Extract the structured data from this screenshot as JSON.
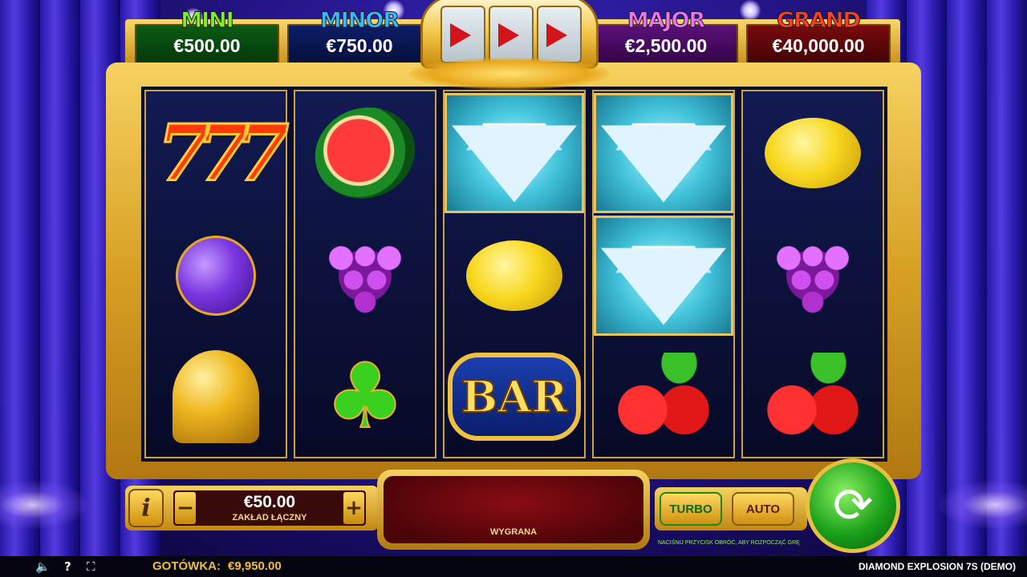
{
  "jackpots": {
    "mini": {
      "label": "MINI",
      "value": "€500.00"
    },
    "minor": {
      "label": "MINOR",
      "value": "€750.00"
    },
    "major": {
      "label": "MAJOR",
      "value": "€2,500.00"
    },
    "grand": {
      "label": "GRAND",
      "value": "€40,000.00"
    }
  },
  "reels": [
    [
      "sevens",
      "plum",
      "bell"
    ],
    [
      "watermelon",
      "grapes",
      "clover"
    ],
    [
      "diamond",
      "lemon",
      "bar"
    ],
    [
      "diamond",
      "diamond",
      "cherries"
    ],
    [
      "lemon",
      "grapes",
      "cherries"
    ]
  ],
  "symbols": {
    "sevens_text": "777",
    "bar_text": "BAR",
    "clover_glyph": "♣"
  },
  "controls": {
    "info_label": "i",
    "minus_label": "−",
    "plus_label": "+",
    "bet_value": "€50.00",
    "bet_label": "ZAKŁAD ŁĄCZNY",
    "win_label": "WYGRANA",
    "turbo_label": "TURBO",
    "auto_label": "AUTO",
    "hint": "NACIŚNIJ PRZYCISK OBRÓĆ, ABY ROZPOCZĄĆ GRĘ",
    "spin_glyph": "⟳"
  },
  "status_bar": {
    "sound_glyph": "🔈",
    "help_glyph": "?",
    "fullscreen_glyph": "⛶",
    "balance_label": "GOTÓWKA:",
    "balance_value": "€9,950.00",
    "game_title": "DIAMOND EXPLOSION 7S (DEMO)"
  },
  "colors": {
    "gold": "#f6d260",
    "spin_green": "#1aa01a",
    "mini": "#7cf02a",
    "minor": "#35b9ff",
    "major": "#f070ff",
    "grand": "#ff4020"
  }
}
